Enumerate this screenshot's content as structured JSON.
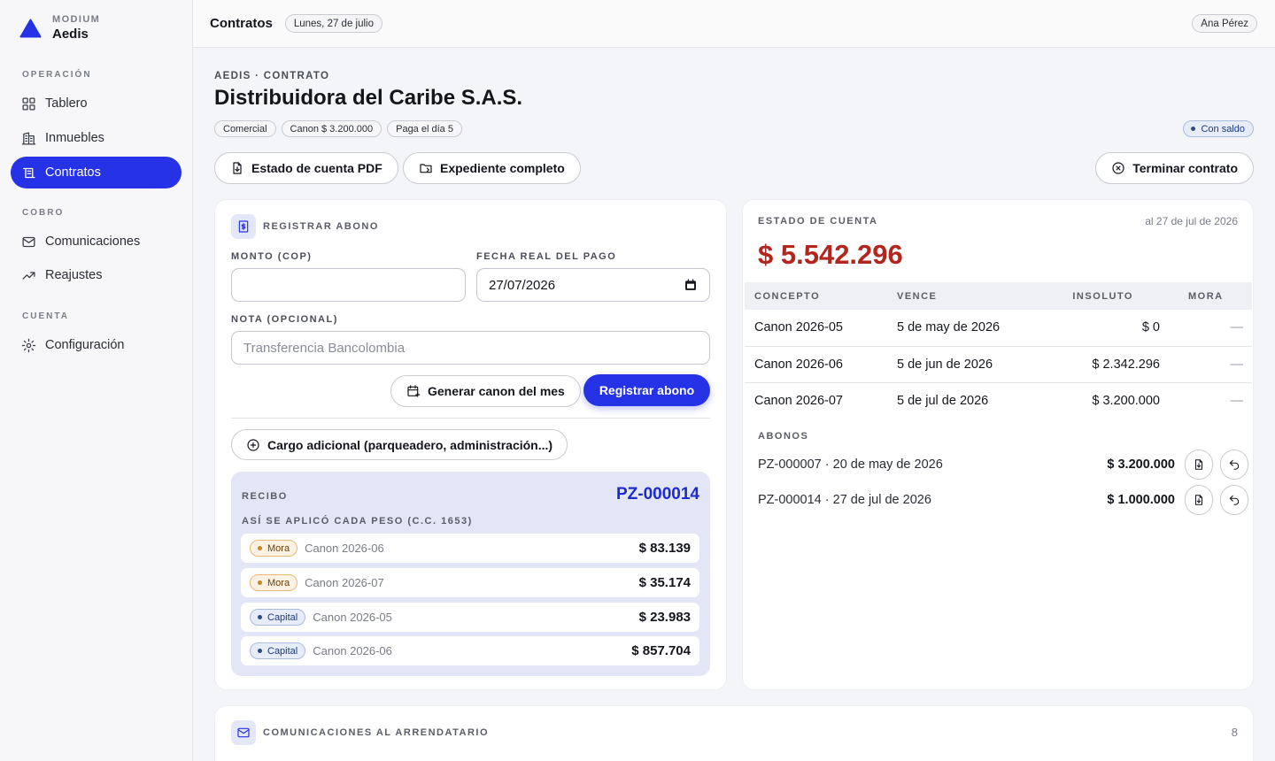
{
  "brand": {
    "small": "MODIUM",
    "name": "Aedis"
  },
  "sidebar": {
    "sections": [
      {
        "label": "OPERACIÓN",
        "items": [
          {
            "label": "Tablero",
            "icon": "dashboard-icon"
          },
          {
            "label": "Inmuebles",
            "icon": "building-icon"
          },
          {
            "label": "Contratos",
            "icon": "contract-icon",
            "active": true
          }
        ]
      },
      {
        "label": "COBRO",
        "items": [
          {
            "label": "Comunicaciones",
            "icon": "mail-icon"
          },
          {
            "label": "Reajustes",
            "icon": "trend-up-icon"
          }
        ]
      },
      {
        "label": "CUENTA",
        "items": [
          {
            "label": "Configuración",
            "icon": "gear-icon"
          }
        ]
      }
    ]
  },
  "topbar": {
    "title": "Contratos",
    "date": "Lunes, 27 de julio",
    "user": "Ana Pérez"
  },
  "header": {
    "breadcrumb": "AEDIS · CONTRATO",
    "title": "Distribuidora del Caribe S.A.S.",
    "tags": [
      "Comercial",
      "Canon $ 3.200.000",
      "Paga el día 5"
    ],
    "status": "Con saldo"
  },
  "actions": {
    "pdf": "Estado de cuenta PDF",
    "expediente": "Expediente completo",
    "terminar": "Terminar contrato"
  },
  "abono": {
    "title": "REGISTRAR ABONO",
    "monto_label": "MONTO (COP)",
    "monto_value": "",
    "fecha_label": "FECHA REAL DEL PAGO",
    "fecha_value": "27/07/2026",
    "nota_label": "NOTA (OPCIONAL)",
    "nota_placeholder": "Transferencia Bancolombia",
    "generar": "Generar canon del mes",
    "registrar": "Registrar abono",
    "cargo": "Cargo adicional (parqueadero, administración...)"
  },
  "recibo": {
    "label": "RECIBO",
    "number": "PZ-000014",
    "subtitle": "ASÍ SE APLICÓ CADA PESO (C.C. 1653)",
    "rows": [
      {
        "type": "Mora",
        "concept": "Canon 2026-06",
        "amount": "$ 83.139"
      },
      {
        "type": "Mora",
        "concept": "Canon 2026-07",
        "amount": "$ 35.174"
      },
      {
        "type": "Capital",
        "concept": "Canon 2026-05",
        "amount": "$ 23.983"
      },
      {
        "type": "Capital",
        "concept": "Canon 2026-06",
        "amount": "$ 857.704"
      }
    ]
  },
  "estado": {
    "title": "ESTADO DE CUENTA",
    "date": "al 27 de jul de 2026",
    "total": "$ 5.542.296",
    "columns": [
      "CONCEPTO",
      "VENCE",
      "INSOLUTO",
      "MORA"
    ],
    "rows": [
      {
        "concepto": "Canon 2026-05",
        "vence": "5 de may de 2026",
        "insoluto": "$ 0",
        "mora": "—"
      },
      {
        "concepto": "Canon 2026-06",
        "vence": "5 de jun de 2026",
        "insoluto": "$ 2.342.296",
        "mora": "—"
      },
      {
        "concepto": "Canon 2026-07",
        "vence": "5 de jul de 2026",
        "insoluto": "$ 3.200.000",
        "mora": "—"
      }
    ],
    "abonos_label": "ABONOS",
    "abonos": [
      {
        "text": "PZ-000007 · 20 de may de 2026",
        "amount": "$ 3.200.000"
      },
      {
        "text": "PZ-000014 · 27 de jul de 2026",
        "amount": "$ 1.000.000"
      }
    ]
  },
  "comunicaciones": {
    "title": "COMUNICACIONES AL ARRENDATARIO",
    "count": "8"
  },
  "colors": {
    "accent": "#2532e6",
    "total_red": "#b3261e",
    "mora": "#c78420",
    "capital": "#2d4a8a"
  }
}
